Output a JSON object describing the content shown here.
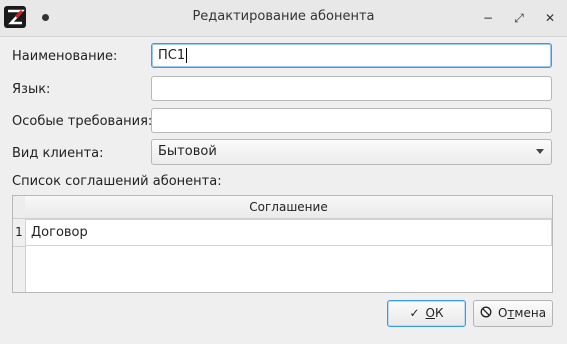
{
  "window": {
    "title": "Редактирование абонента",
    "minimize_glyph": "−",
    "maximize_glyph": "⤢",
    "close_glyph": "✕"
  },
  "form": {
    "name_label": "Наименование:",
    "name_value": "ПС1",
    "language_label": "Язык:",
    "language_value": "",
    "requirements_label": "Особые требования:",
    "requirements_value": "",
    "client_type_label": "Вид клиента:",
    "client_type_value": "Бытовой",
    "agreements_label": "Список соглашений абонента:"
  },
  "table": {
    "columns": [
      "Соглашение"
    ],
    "rows": [
      {
        "num": "1",
        "agreement": "Договор"
      }
    ]
  },
  "buttons": {
    "ok_icon": "✓",
    "ok_label_u": "О",
    "ok_label_rest": "К",
    "cancel_icon": "⃠",
    "cancel_label_pre": "О",
    "cancel_label_u": "т",
    "cancel_label_rest": "мена"
  },
  "icons": {
    "app": "app-logo-icon",
    "window_menu": "dot-icon",
    "ok": "check-icon",
    "cancel": "prohibit-icon",
    "dropdown": "chevron-down-icon"
  }
}
